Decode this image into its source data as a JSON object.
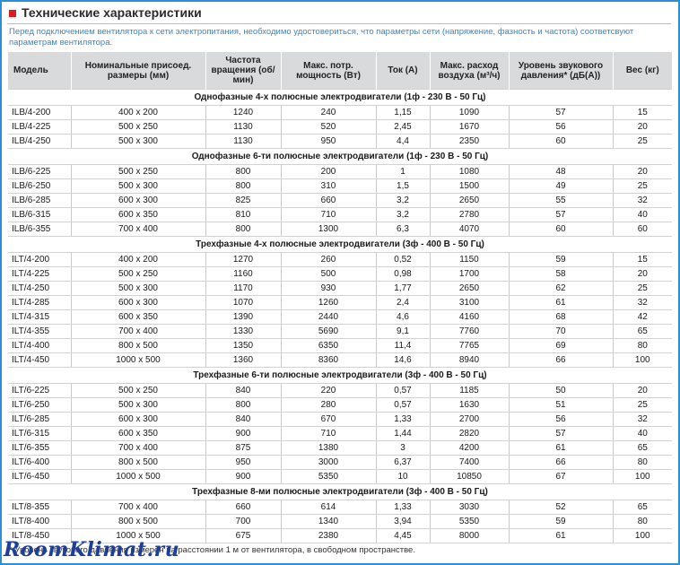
{
  "header": {
    "title": "Технические характеристики"
  },
  "intro": "Перед подключением вентилятора к сети электропитания, необходимо удостовериться, что параметры сети (напряжение, фазность и частота) соответсвуют параметрам вентилятора.",
  "columns": {
    "model": "Модель",
    "size": "Номинальные присоед. размеры (мм)",
    "speed": "Частота вращения (об/мин)",
    "power": "Макс. потр. мощность (Вт)",
    "current": "Ток (А)",
    "airflow": "Макс. расход воздуха (м³/ч)",
    "noise": "Уровень звукового давления* (дБ(А))",
    "weight": "Вес (кг)"
  },
  "sections": [
    {
      "title": "Однофазные 4-х полюсные электродвигатели (1ф - 230 В - 50 Гц)",
      "rows": [
        [
          "ILB/4-200",
          "400 x 200",
          "1240",
          "240",
          "1,15",
          "1090",
          "57",
          "15"
        ],
        [
          "ILB/4-225",
          "500 x 250",
          "1130",
          "520",
          "2,45",
          "1670",
          "56",
          "20"
        ],
        [
          "ILB/4-250",
          "500 x 300",
          "1130",
          "950",
          "4,4",
          "2350",
          "60",
          "25"
        ]
      ]
    },
    {
      "title": "Однофазные 6-ти полюсные электродвигатели (1ф - 230 В - 50 Гц)",
      "rows": [
        [
          "ILB/6-225",
          "500 x 250",
          "800",
          "200",
          "1",
          "1080",
          "48",
          "20"
        ],
        [
          "ILB/6-250",
          "500 x 300",
          "800",
          "310",
          "1,5",
          "1500",
          "49",
          "25"
        ],
        [
          "ILB/6-285",
          "600 x 300",
          "825",
          "660",
          "3,2",
          "2650",
          "55",
          "32"
        ],
        [
          "ILB/6-315",
          "600 x 350",
          "810",
          "710",
          "3,2",
          "2780",
          "57",
          "40"
        ],
        [
          "ILB/6-355",
          "700 x 400",
          "800",
          "1300",
          "6,3",
          "4070",
          "60",
          "60"
        ]
      ]
    },
    {
      "title": "Трехфазные 4-х полюсные электродвигатели (3ф - 400 В - 50 Гц)",
      "rows": [
        [
          "ILT/4-200",
          "400 x 200",
          "1270",
          "260",
          "0,52",
          "1150",
          "59",
          "15"
        ],
        [
          "ILT/4-225",
          "500 x 250",
          "1160",
          "500",
          "0,98",
          "1700",
          "58",
          "20"
        ],
        [
          "ILT/4-250",
          "500 x 300",
          "1170",
          "930",
          "1,77",
          "2650",
          "62",
          "25"
        ],
        [
          "ILT/4-285",
          "600 x 300",
          "1070",
          "1260",
          "2,4",
          "3100",
          "61",
          "32"
        ],
        [
          "ILT/4-315",
          "600 x 350",
          "1390",
          "2440",
          "4,6",
          "4160",
          "68",
          "42"
        ],
        [
          "ILT/4-355",
          "700 x 400",
          "1330",
          "5690",
          "9,1",
          "7760",
          "70",
          "65"
        ],
        [
          "ILT/4-400",
          "800 x 500",
          "1350",
          "6350",
          "11,4",
          "7765",
          "69",
          "80"
        ],
        [
          "ILT/4-450",
          "1000 x 500",
          "1360",
          "8360",
          "14,6",
          "8940",
          "66",
          "100"
        ]
      ]
    },
    {
      "title": "Трехфазные 6-ти полюсные электродвигатели (3ф - 400 В - 50 Гц)",
      "rows": [
        [
          "ILT/6-225",
          "500 x 250",
          "840",
          "220",
          "0,57",
          "1185",
          "50",
          "20"
        ],
        [
          "ILT/6-250",
          "500 x 300",
          "800",
          "280",
          "0,57",
          "1630",
          "51",
          "25"
        ],
        [
          "ILT/6-285",
          "600 x 300",
          "840",
          "670",
          "1,33",
          "2700",
          "56",
          "32"
        ],
        [
          "ILT/6-315",
          "600 x 350",
          "900",
          "710",
          "1,44",
          "2820",
          "57",
          "40"
        ],
        [
          "ILT/6-355",
          "700 x 400",
          "875",
          "1380",
          "3",
          "4200",
          "61",
          "65"
        ],
        [
          "ILT/6-400",
          "800 x 500",
          "950",
          "3000",
          "6,37",
          "7400",
          "66",
          "80"
        ],
        [
          "ILT/6-450",
          "1000 x 500",
          "900",
          "5350",
          "10",
          "10850",
          "67",
          "100"
        ]
      ]
    },
    {
      "title": "Трехфазные 8-ми полюсные электродвигатели (3ф - 400 В - 50 Гц)",
      "rows": [
        [
          "ILT/8-355",
          "700 x 400",
          "660",
          "614",
          "1,33",
          "3030",
          "52",
          "65"
        ],
        [
          "ILT/8-400",
          "800 x 500",
          "700",
          "1340",
          "3,94",
          "5350",
          "59",
          "80"
        ],
        [
          "ILT/8-450",
          "1000 x 500",
          "675",
          "2380",
          "4,45",
          "8000",
          "61",
          "100"
        ]
      ]
    }
  ],
  "footnote": "* Уровень звукового давления измерен на расстоянии 1 м от вентилятора, в свободном пространстве.",
  "watermark": "RoomKlimat.ru",
  "colors": {
    "accent": "#d62020",
    "intro_text": "#3c86c4",
    "header_bg": "#d8dadc",
    "frame": "#2a8fd6",
    "watermark": "#1d3f9a"
  }
}
